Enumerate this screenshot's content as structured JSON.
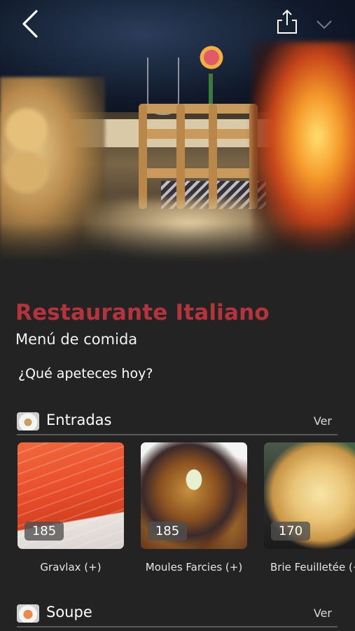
{
  "header": {
    "back_icon": "chevron-left-icon",
    "share_icon": "share-icon",
    "extra_icon": "chevron-down-icon"
  },
  "restaurant": {
    "name": "Restaurante Italiano",
    "subtitle": "Menú de comida",
    "prompt": "¿Qué apeteces hoy?",
    "accent_color": "#b5333b"
  },
  "sections": [
    {
      "title": "Entradas",
      "link_label": "Ver",
      "items": [
        {
          "name": "Gravlax (+)",
          "price": "185"
        },
        {
          "name": "Moules Farcies (+)",
          "price": "185"
        },
        {
          "name": "Brie Feuilletée (+",
          "price": "170"
        }
      ]
    },
    {
      "title": "Soupe",
      "link_label": "Ver"
    }
  ]
}
